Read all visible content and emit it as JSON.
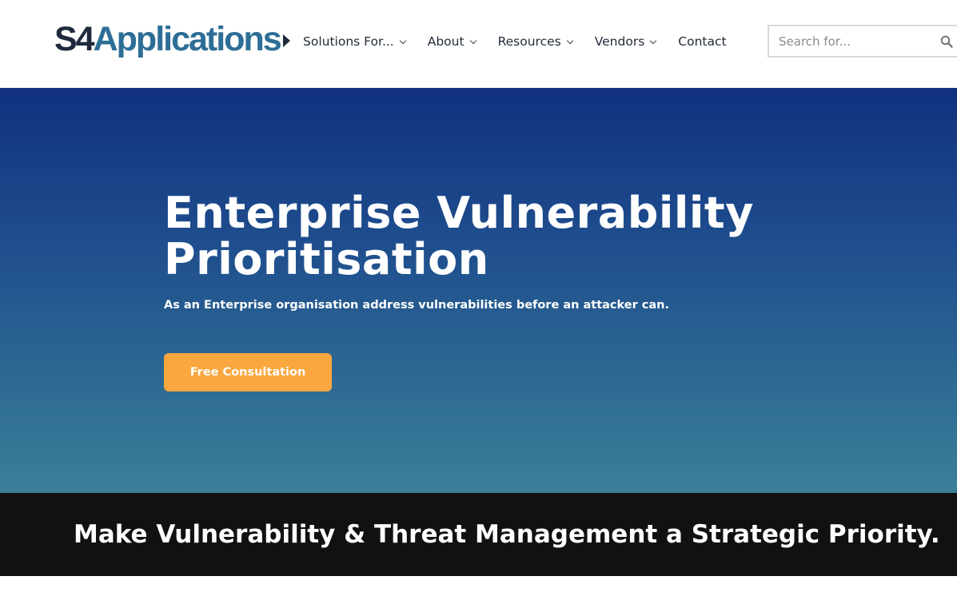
{
  "header": {
    "logo": {
      "part1": "S4",
      "part2": "Applications"
    },
    "nav": [
      {
        "label": "Solutions For...",
        "has_dropdown": true
      },
      {
        "label": "About",
        "has_dropdown": true
      },
      {
        "label": "Resources",
        "has_dropdown": true
      },
      {
        "label": "Vendors",
        "has_dropdown": true
      },
      {
        "label": "Contact",
        "has_dropdown": false
      }
    ],
    "search": {
      "placeholder": "Search for...",
      "value": "",
      "icon": "search-icon"
    }
  },
  "hero": {
    "title": "Enterprise Vulnerability Prioritisation",
    "subtitle": "As an Enterprise organisation address vulnerabilities before an attacker can.",
    "cta_label": "Free Consultation"
  },
  "band": {
    "text": "Make Vulnerability & Threat Management a Strategic Priority."
  },
  "colors": {
    "brand_dark": "#1e2a3c",
    "brand_blue": "#2d6e96",
    "hero_top": "#11317f",
    "hero_bottom": "#3a7f98",
    "cta": "#f9a73e",
    "band": "#111111"
  }
}
